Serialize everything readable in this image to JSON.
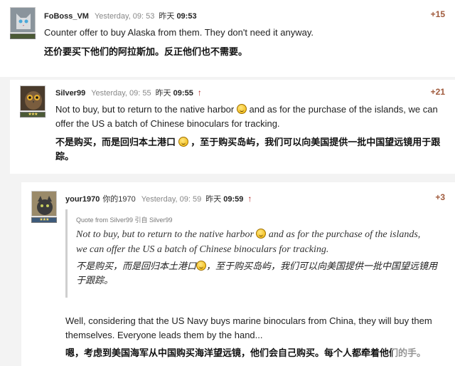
{
  "comments": [
    {
      "user": "FoBoss_VM",
      "time": "Yesterday, 09: 53",
      "time_cn_prefix": "昨天",
      "time_cn": "09:53",
      "score": "+15",
      "text_en": "Counter offer to buy Alaska from them. They don't need it anyway.",
      "text_cn": "还价要买下他们的阿拉斯加。反正他们也不需要。"
    },
    {
      "user": "Silver99",
      "time": "Yesterday, 09: 55",
      "time_cn_prefix": "昨天",
      "time_cn": "09:55",
      "arrow": "↑",
      "score": "+21",
      "text_en_a": "Not to buy, but to return to the native harbor",
      "text_en_b": "and as for the purchase of the islands, we can offer the US a batch of Chinese binoculars for tracking.",
      "text_cn_a": "不是购买，而是回归本土港口",
      "text_cn_b": "，至于购买岛屿，我们可以向美国提供一批中国望远镜用于跟踪。"
    },
    {
      "user": "your1970",
      "user_alt": "你的1970",
      "time": "Yesterday, 09: 59",
      "time_cn_prefix": "昨天",
      "time_cn": "09:59",
      "arrow": "↑",
      "score": "+3",
      "quote_head": "Quote from Silver99 引自 Silver99",
      "quote_en_a": "Not to buy, but to return to the native harbor",
      "quote_en_b": "and as for the purchase of the islands, we can offer the US a batch of Chinese binoculars for tracking.",
      "quote_cn_a": "不是购买，而是回归本土港口",
      "quote_cn_b": "，至于购买岛屿，我们可以向美国提供一批中国望远镜用于跟踪。",
      "text_en": "Well, considering that the US Navy buys marine binoculars from China, they will buy them themselves. Everyone leads them by the hand...",
      "text_cn": "嗯，考虑到美国海军从中国购买海洋望远镜，他们会自己购买。每个人都牵着他们的手。"
    }
  ],
  "icons": {
    "emoji": "smiley-icon",
    "vote": "arrow-up-icon"
  }
}
